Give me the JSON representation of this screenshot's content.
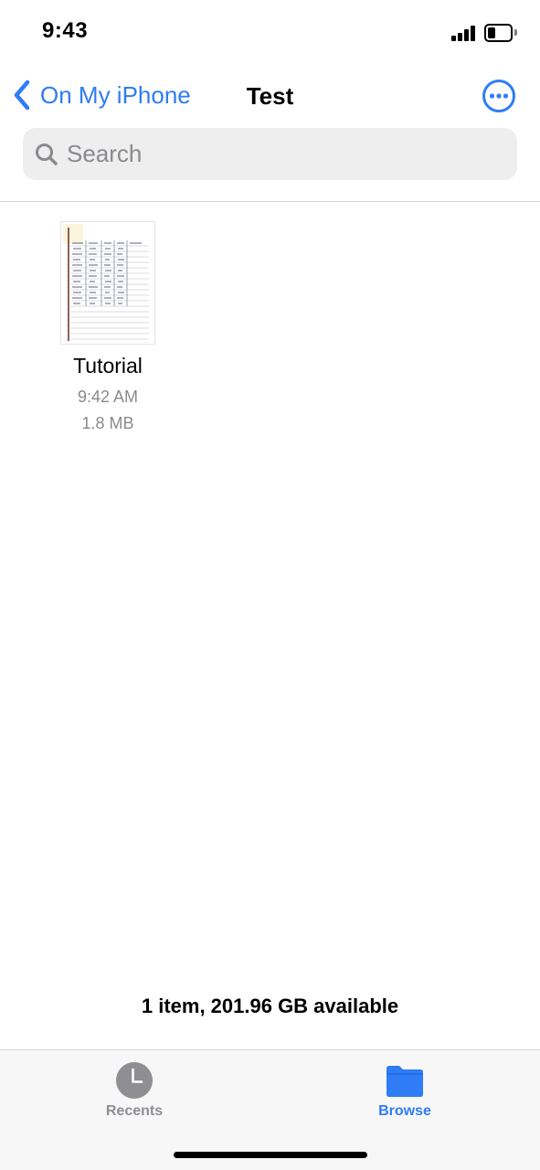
{
  "status_bar": {
    "time": "9:43",
    "icons": [
      "signal-icon",
      "battery-icon"
    ]
  },
  "nav": {
    "back_label": "On My iPhone",
    "title": "Test",
    "icons": [
      "chevron-left-icon",
      "ellipsis-circle-icon"
    ]
  },
  "search": {
    "placeholder": "Search",
    "icon": "search-icon"
  },
  "files": [
    {
      "name": "Tutorial",
      "time": "9:42 AM",
      "size": "1.8 MB"
    }
  ],
  "footer": {
    "storage_text": "1 item, 201.96 GB available"
  },
  "tabs": [
    {
      "label": "Recents",
      "icon": "clock-icon",
      "selected": false
    },
    {
      "label": "Browse",
      "icon": "folder-icon",
      "selected": true
    }
  ],
  "colors": {
    "accent": "#2f7cf6",
    "secondary_text": "#8a8a8e",
    "search_background": "#eeeeef",
    "tab_bar_background": "#f7f7f8"
  }
}
